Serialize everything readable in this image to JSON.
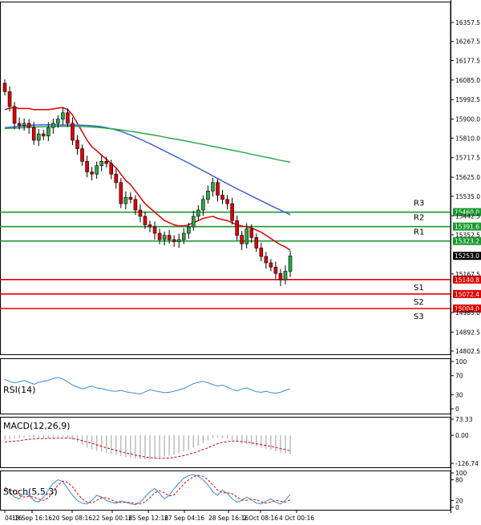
{
  "chart_data": [
    {
      "type": "candlestick",
      "panel": "price",
      "title": "",
      "y_ticks": [
        "16357.5",
        "16267.5",
        "16177.5",
        "16085.0",
        "15992.5",
        "15900.0",
        "15810.0",
        "15717.5",
        "15625.0",
        "15535.0",
        "15442.5",
        "15352.5",
        "15167.5",
        "14985.0",
        "14892.5",
        "14802.5"
      ],
      "ylim": [
        14802.5,
        16357.5
      ],
      "x_ticks": [
        "04:16",
        "18 Sep 16:16",
        "20 Sep 08:16",
        "22 Sep 00:16",
        "25 Sep 12:16",
        "27 Sep 04:16",
        "28 Sep 16:16",
        "2 Oct 08:16",
        "4 Oct 00:16"
      ],
      "levels": [
        {
          "name": "R3",
          "value": 15460.0,
          "price_label": "15460.0",
          "color": "#1a9a2e"
        },
        {
          "name": "R2",
          "value": 15391.6,
          "price_label": "15391.6",
          "color": "#1a9a2e"
        },
        {
          "name": "R1",
          "value": 15323.2,
          "price_label": "15323.2",
          "color": "#1a9a2e"
        },
        {
          "name": "S1",
          "value": 15140.8,
          "price_label": "15140.8",
          "color": "#e00000"
        },
        {
          "name": "S2",
          "value": 15072.4,
          "price_label": "15072.4",
          "color": "#e00000"
        },
        {
          "name": "S3",
          "value": 15004.0,
          "price_label": "15004.0",
          "color": "#e00000"
        }
      ],
      "last_price": {
        "value": 15253.0,
        "label": "15253.0"
      },
      "candles_close": [
        16030,
        15960,
        15880,
        15870,
        15880,
        15860,
        15800,
        15830,
        15820,
        15860,
        15880,
        15900,
        15930,
        15880,
        15800,
        15760,
        15700,
        15650,
        15640,
        15680,
        15700,
        15690,
        15640,
        15600,
        15500,
        15530,
        15520,
        15470,
        15440,
        15400,
        15390,
        15360,
        15330,
        15350,
        15330,
        15320,
        15330,
        15360,
        15390,
        15440,
        15470,
        15520,
        15560,
        15600,
        15540,
        15520,
        15500,
        15420,
        15350,
        15310,
        15380,
        15340,
        15290,
        15250,
        15220,
        15200,
        15170,
        15140,
        15180,
        15253
      ],
      "series": [
        {
          "color": "#e00000",
          "values": [
            15945,
            15952,
            15955,
            15950,
            15950,
            15950,
            15945,
            15945,
            15945,
            15945,
            15948,
            15952,
            15955,
            15945,
            15920,
            15880,
            15840,
            15800,
            15770,
            15750,
            15730,
            15710,
            15690,
            15670,
            15640,
            15610,
            15590,
            15560,
            15530,
            15500,
            15480,
            15460,
            15440,
            15420,
            15410,
            15400,
            15395,
            15395,
            15400,
            15410,
            15420,
            15430,
            15435,
            15440,
            15430,
            15425,
            15420,
            15410,
            15400,
            15395,
            15390,
            15385,
            15375,
            15365,
            15350,
            15335,
            15320,
            15305,
            15295,
            15280
          ]
        },
        {
          "color": "#4060d8",
          "values": [
            15860,
            15862,
            15865,
            15867,
            15870,
            15872,
            15873,
            15873,
            15873,
            15872,
            15872,
            15872,
            15871,
            15870,
            15868,
            15865,
            15860,
            15853,
            15845,
            15835,
            15823,
            15810,
            15796,
            15782,
            15767,
            15752,
            15737,
            15722,
            15707,
            15692,
            15676,
            15660,
            15644,
            15628,
            15612,
            15596,
            15580,
            15565,
            15550,
            15535,
            15520,
            15505,
            15490,
            15476,
            15462,
            15448
          ]
        },
        {
          "color": "#2aa84a",
          "values": [
            15855,
            15857,
            15858,
            15860,
            15862,
            15863,
            15864,
            15865,
            15866,
            15866,
            15866,
            15866,
            15865,
            15864,
            15862,
            15860,
            15857,
            15854,
            15850,
            15846,
            15842,
            15837,
            15832,
            15827,
            15822,
            15816,
            15810,
            15805,
            15800,
            15794,
            15788,
            15782,
            15776,
            15770,
            15764,
            15758,
            15752,
            15746,
            15740,
            15733,
            15727,
            15721,
            15715,
            15708,
            15702,
            15696
          ]
        }
      ]
    },
    {
      "type": "line",
      "panel": "rsi",
      "label": "RSI(14)",
      "y_ticks": [
        "100",
        "70",
        "30",
        "0"
      ],
      "ylim": [
        0,
        100
      ],
      "series": [
        {
          "color": "#3a8ad8",
          "values": [
            62,
            58,
            55,
            57,
            60,
            56,
            52,
            56,
            58,
            60,
            64,
            66,
            63,
            57,
            50,
            46,
            42,
            45,
            48,
            44,
            43,
            40,
            38,
            37,
            39,
            36,
            34,
            33,
            31,
            36,
            40,
            38,
            36,
            34,
            35,
            37,
            40,
            43,
            48,
            53,
            56,
            58,
            55,
            51,
            48,
            50,
            46,
            41,
            38,
            42,
            44,
            40,
            36,
            35,
            37,
            34,
            33,
            35,
            39,
            42
          ]
        }
      ]
    },
    {
      "type": "bar",
      "panel": "macd",
      "label": "MACD(12,26,9)",
      "y_ticks": [
        "73.33",
        "0.00",
        "-126.74"
      ],
      "ylim": [
        -126.74,
        73.33
      ],
      "values": [
        -20,
        -18,
        -15,
        -12,
        -10,
        -8,
        -10,
        -12,
        -14,
        -14,
        -12,
        -8,
        -6,
        -10,
        -20,
        -32,
        -44,
        -55,
        -64,
        -70,
        -74,
        -78,
        -84,
        -88,
        -94,
        -98,
        -102,
        -106,
        -108,
        -110,
        -108,
        -104,
        -100,
        -96,
        -92,
        -88,
        -82,
        -74,
        -66,
        -56,
        -46,
        -36,
        -24,
        -14,
        -10,
        -12,
        -14,
        -22,
        -30,
        -38,
        -40,
        -44,
        -50,
        -56,
        -60,
        -66,
        -72,
        -78,
        -82,
        -86
      ],
      "signal": [
        -30,
        -28,
        -26,
        -24,
        -21,
        -18,
        -16,
        -15,
        -15,
        -14,
        -14,
        -13,
        -12,
        -12,
        -14,
        -18,
        -24,
        -30,
        -36,
        -43,
        -50,
        -56,
        -62,
        -68,
        -74,
        -80,
        -84,
        -90,
        -94,
        -98,
        -101,
        -103,
        -104,
        -104,
        -103,
        -100,
        -96,
        -92,
        -86,
        -80,
        -72,
        -64,
        -56,
        -46,
        -38,
        -32,
        -28,
        -26,
        -26,
        -28,
        -30,
        -34,
        -38,
        -42,
        -46,
        -50,
        -55,
        -60,
        -65,
        -70
      ],
      "signal_color": "#e00000"
    },
    {
      "type": "line",
      "panel": "stoch",
      "label": "Stoch(5,5,3)",
      "y_ticks": [
        "100",
        "80",
        "20",
        "0"
      ],
      "ylim": [
        0,
        100
      ],
      "series": [
        {
          "color": "#3a8ad8",
          "values": [
            60,
            45,
            30,
            25,
            40,
            35,
            20,
            15,
            30,
            50,
            70,
            80,
            75,
            55,
            35,
            20,
            12,
            10,
            20,
            35,
            30,
            20,
            15,
            12,
            18,
            15,
            10,
            8,
            15,
            30,
            45,
            55,
            40,
            25,
            35,
            55,
            70,
            85,
            92,
            95,
            90,
            80,
            65,
            45,
            35,
            50,
            40,
            25,
            15,
            20,
            30,
            22,
            12,
            10,
            18,
            25,
            15,
            10,
            20,
            38
          ]
        },
        {
          "color": "#e00000",
          "dash": true,
          "values": [
            50,
            52,
            45,
            35,
            30,
            32,
            30,
            24,
            20,
            28,
            45,
            65,
            76,
            72,
            60,
            40,
            25,
            15,
            13,
            20,
            28,
            28,
            22,
            16,
            14,
            15,
            14,
            11,
            10,
            16,
            28,
            42,
            48,
            42,
            33,
            36,
            52,
            68,
            80,
            89,
            93,
            90,
            80,
            65,
            50,
            42,
            42,
            40,
            30,
            22,
            20,
            24,
            22,
            16,
            12,
            16,
            20,
            18,
            15,
            22
          ]
        }
      ]
    }
  ]
}
